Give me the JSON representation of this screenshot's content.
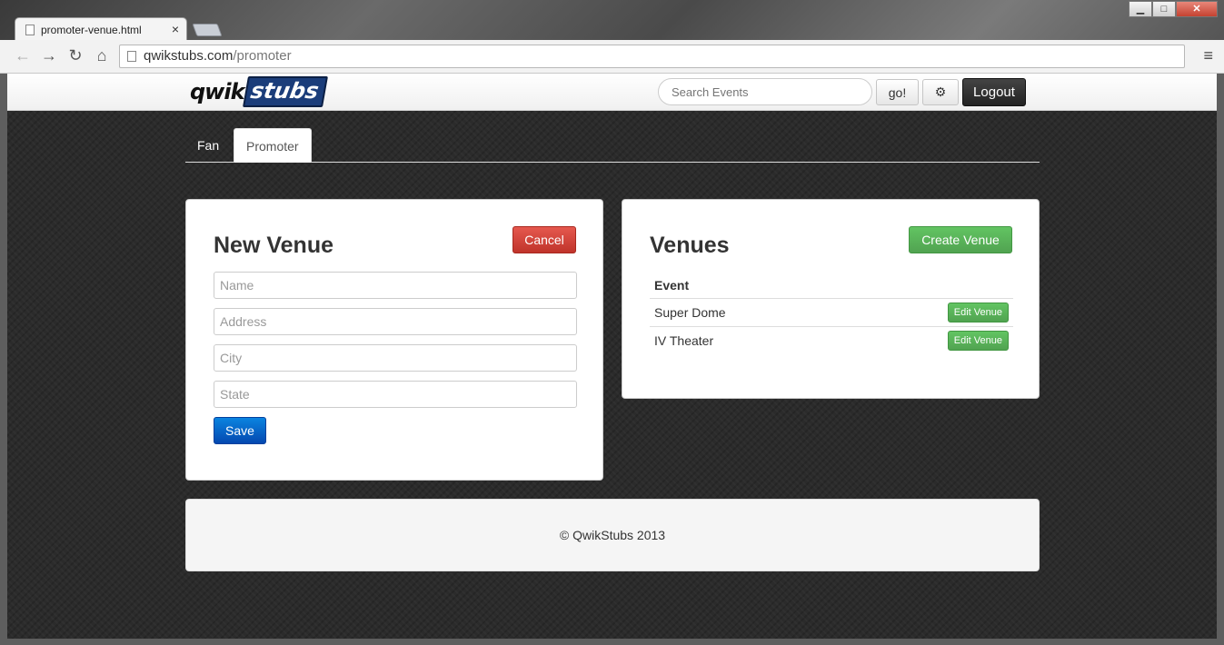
{
  "browser": {
    "tab_title": "promoter-venue.html",
    "tab_close": "×",
    "url_host": "qwikstubs.com",
    "url_path": "/promoter",
    "window_controls": {
      "minimize": "▁",
      "maximize": "□",
      "close": "✕"
    },
    "icons": {
      "back": "←",
      "forward": "→",
      "reload": "↻",
      "home": "⌂",
      "menu": "≡"
    }
  },
  "navbar": {
    "logo_part1": "qwik",
    "logo_part2": "stubs",
    "search_placeholder": "Search Events",
    "go_label": "go!",
    "gear_icon": "⚙",
    "logout_label": "Logout"
  },
  "tabs": [
    {
      "label": "Fan",
      "active": false
    },
    {
      "label": "Promoter",
      "active": true
    }
  ],
  "new_venue": {
    "title": "New Venue",
    "cancel_label": "Cancel",
    "fields": {
      "name": "Name",
      "address": "Address",
      "city": "City",
      "state": "State"
    },
    "save_label": "Save"
  },
  "venues": {
    "title": "Venues",
    "create_label": "Create Venue",
    "column_header": "Event",
    "rows": [
      {
        "name": "Super Dome",
        "action": "Edit Venue"
      },
      {
        "name": "IV Theater",
        "action": "Edit Venue"
      }
    ]
  },
  "footer": {
    "text": "© QwikStubs 2013"
  },
  "colors": {
    "danger": "#c0342b",
    "primary": "#0448b0",
    "success": "#51a351",
    "logo_blue": "#1b3d7a"
  }
}
